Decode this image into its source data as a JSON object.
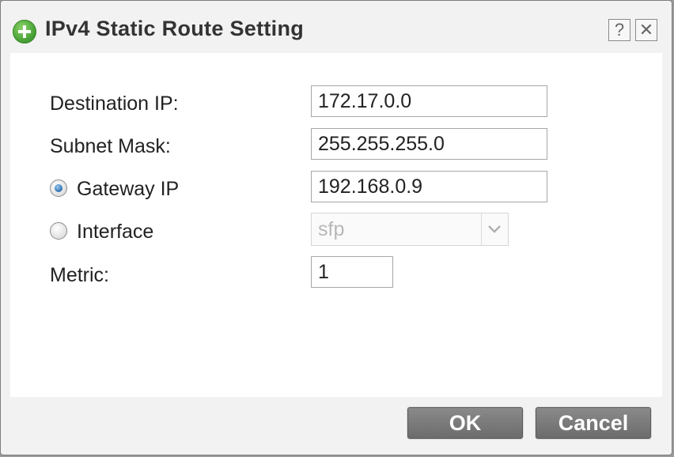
{
  "dialog": {
    "title": "IPv4 Static Route Setting",
    "icon": "add-circle-icon",
    "help_label": "?",
    "close_label": "✕"
  },
  "form": {
    "destination_ip_label": "Destination IP:",
    "destination_ip_value": "172.17.0.0",
    "subnet_mask_label": "Subnet Mask:",
    "subnet_mask_value": "255.255.255.0",
    "gateway_ip_label": "Gateway IP",
    "gateway_ip_value": "192.168.0.9",
    "gateway_selected": true,
    "interface_label": "Interface",
    "interface_value": "sfp",
    "interface_selected": false,
    "metric_label": "Metric:",
    "metric_value": "1"
  },
  "buttons": {
    "ok_label": "OK",
    "cancel_label": "Cancel"
  }
}
